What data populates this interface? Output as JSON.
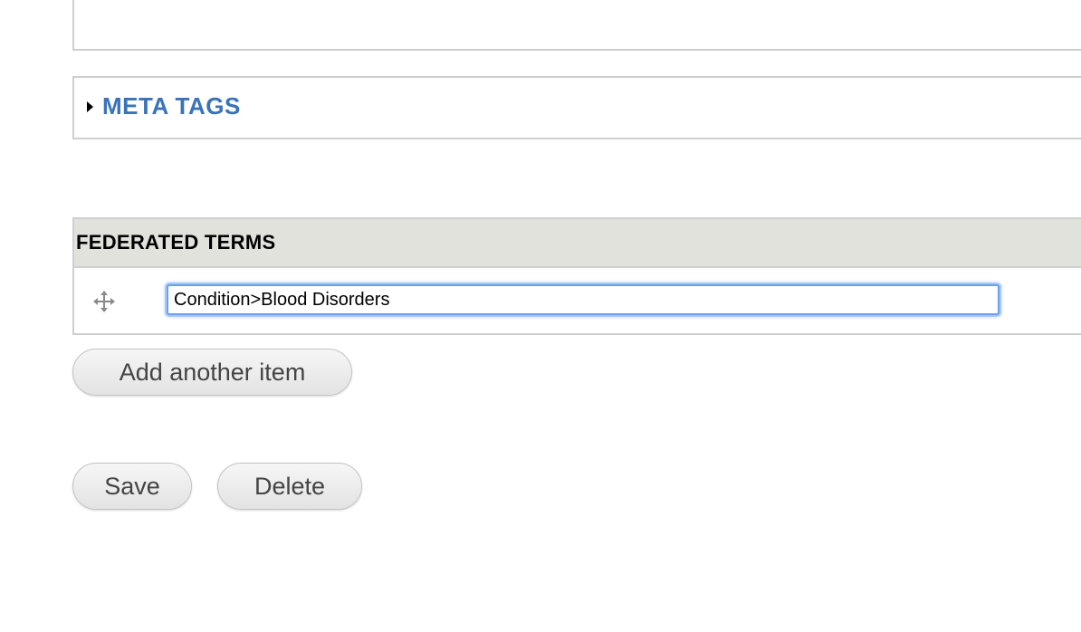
{
  "meta_tags": {
    "title": "META TAGS"
  },
  "federated_terms": {
    "header": "FEDERATED TERMS",
    "items": [
      {
        "value": "Condition>Blood Disorders"
      }
    ],
    "add_label": "Add another item"
  },
  "actions": {
    "save_label": "Save",
    "delete_label": "Delete"
  },
  "colors": {
    "link": "#3b73b9",
    "header_bg": "#e1e2dc",
    "focus_border": "#6aa0f0"
  },
  "icons": {
    "collapse": "triangle-right-icon",
    "drag": "drag-handle-icon"
  }
}
